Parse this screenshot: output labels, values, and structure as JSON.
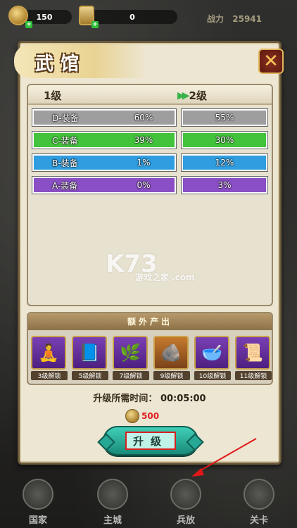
{
  "topbar": {
    "gold": "150",
    "scrolls": "0",
    "power_label": "战力",
    "power_value": "25941"
  },
  "panel": {
    "title": "武馆",
    "close_symbol": "✕",
    "level_current": "1级",
    "level_next": "2级",
    "rows": [
      {
        "name": "D-装备",
        "current": "60%",
        "next": "55%",
        "color": "#9e9e9e"
      },
      {
        "name": "C-装备",
        "current": "39%",
        "next": "30%",
        "color": "#43c33b"
      },
      {
        "name": "B-装备",
        "current": "1%",
        "next": "12%",
        "color": "#2f9ddf"
      },
      {
        "name": "A-装备",
        "current": "0%",
        "next": "3%",
        "color": "#8a4fc4"
      }
    ],
    "extra_title": "额外产出",
    "extra_items": [
      {
        "icon": "🧘",
        "label": "3级解锁",
        "box": "purple"
      },
      {
        "icon": "📘",
        "label": "5级解锁",
        "box": "purple"
      },
      {
        "icon": "🌿",
        "label": "7级解锁",
        "box": "purple"
      },
      {
        "icon": "🪨",
        "label": "9级解锁",
        "box": "orange"
      },
      {
        "icon": "🥣",
        "label": "10级解锁",
        "box": "purple"
      },
      {
        "icon": "📜",
        "label": "11级解锁",
        "box": "purple"
      }
    ],
    "time_label": "升级所需时间：",
    "time_value": "00:05:00",
    "cost": "500",
    "upgrade_label": "升级"
  },
  "watermark": {
    "main": "K73",
    "sub": "游戏之家 .com"
  },
  "bottom_nav": [
    {
      "label": "国家"
    },
    {
      "label": "主城"
    },
    {
      "label": "兵放"
    },
    {
      "label": "关卡"
    }
  ]
}
